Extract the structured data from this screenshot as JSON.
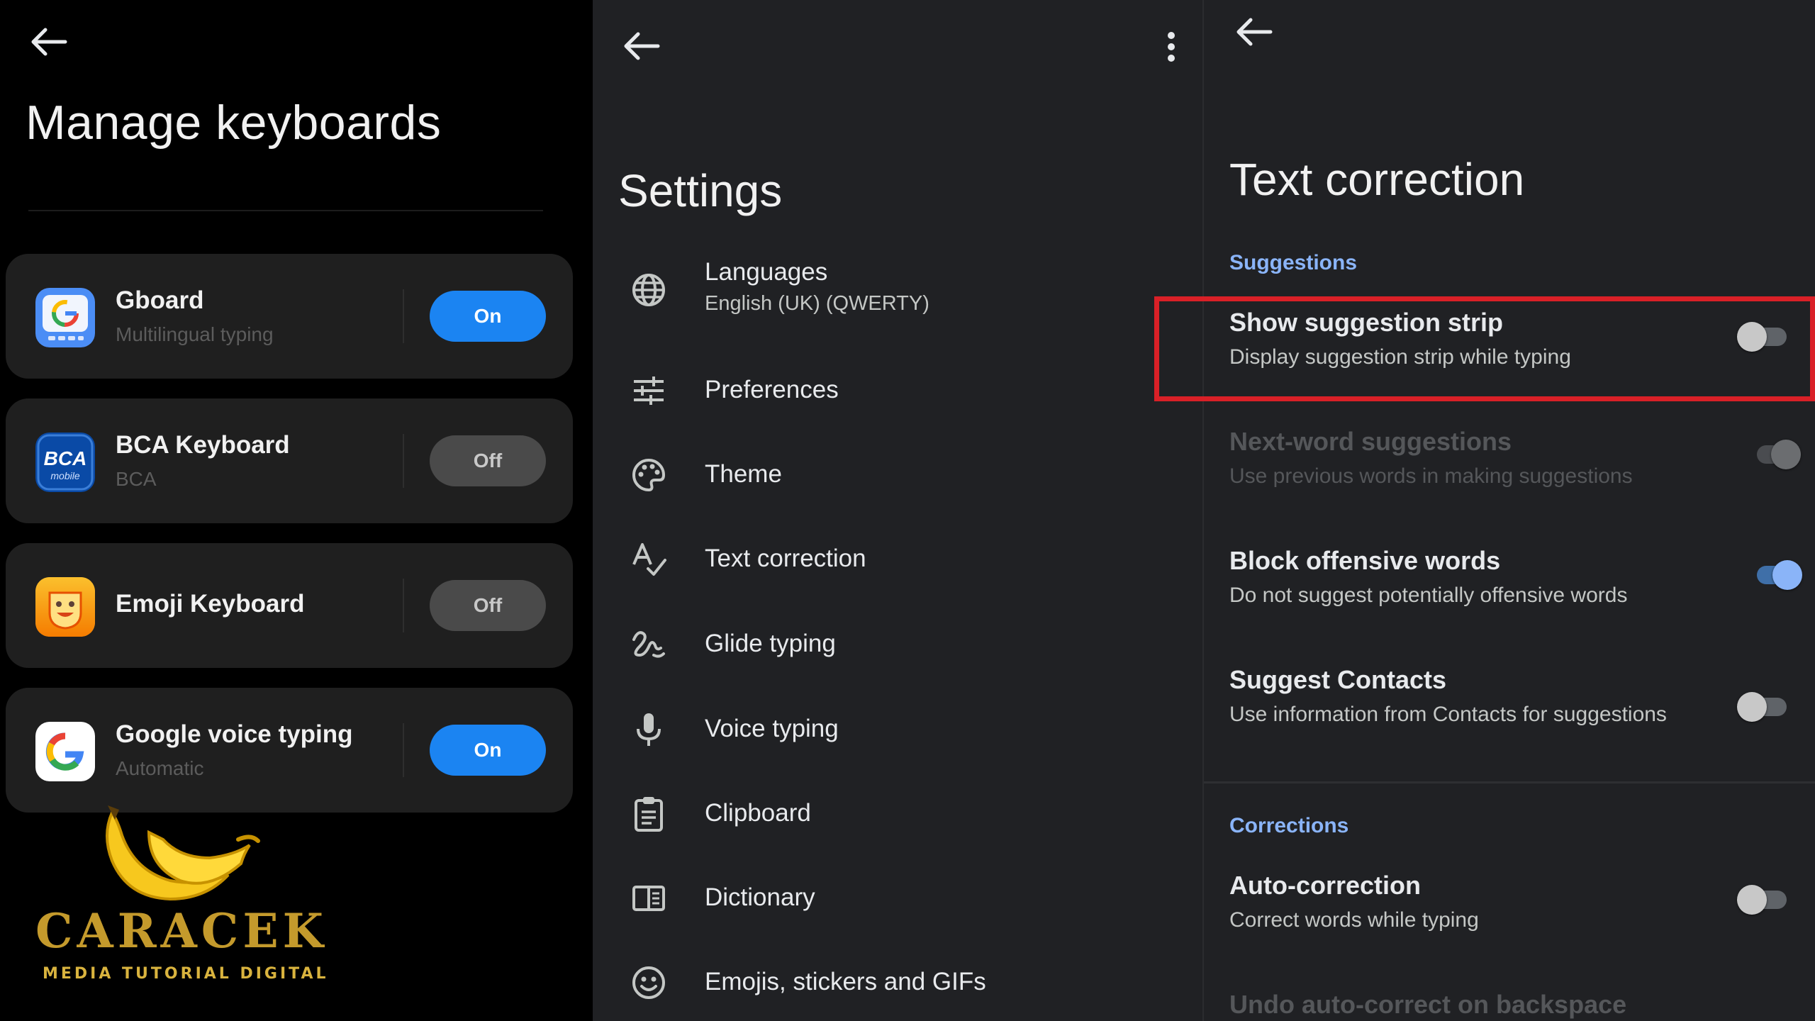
{
  "manage": {
    "title": "Manage keyboards",
    "keyboards": [
      {
        "name": "Gboard",
        "subtitle": "Multilingual typing",
        "status": "On"
      },
      {
        "name": "BCA Keyboard",
        "subtitle": "BCA",
        "status": "Off"
      },
      {
        "name": "Emoji Keyboard",
        "subtitle": "",
        "status": "Off"
      },
      {
        "name": "Google voice typing",
        "subtitle": "Automatic",
        "status": "On"
      }
    ],
    "bca_logo_text": "BCA",
    "bca_logo_sub": "mobile"
  },
  "watermark": {
    "brand": "CARACEK",
    "tagline": "MEDIA TUTORIAL DIGITAL"
  },
  "settings": {
    "title": "Settings",
    "items": [
      {
        "label": "Languages",
        "subtitle": "English (UK) (QWERTY)",
        "icon": "globe-icon"
      },
      {
        "label": "Preferences",
        "icon": "sliders-icon"
      },
      {
        "label": "Theme",
        "icon": "palette-icon"
      },
      {
        "label": "Text correction",
        "icon": "spellcheck-icon"
      },
      {
        "label": "Glide typing",
        "icon": "gesture-icon"
      },
      {
        "label": "Voice typing",
        "icon": "mic-icon"
      },
      {
        "label": "Clipboard",
        "icon": "clipboard-icon"
      },
      {
        "label": "Dictionary",
        "icon": "book-icon"
      },
      {
        "label": "Emojis, stickers and GIFs",
        "icon": "smiley-icon"
      }
    ]
  },
  "text_correction": {
    "title": "Text correction",
    "sections": {
      "suggestions": "Suggestions",
      "corrections": "Corrections"
    },
    "items": [
      {
        "label": "Show suggestion strip",
        "subtitle": "Display suggestion strip while typing",
        "state": "off"
      },
      {
        "label": "Next-word suggestions",
        "subtitle": "Use previous words in making suggestions",
        "state": "disabled"
      },
      {
        "label": "Block offensive words",
        "subtitle": "Do not suggest potentially offensive words",
        "state": "on"
      },
      {
        "label": "Suggest Contacts",
        "subtitle": "Use information from Contacts for suggestions",
        "state": "off"
      },
      {
        "label": "Auto-correction",
        "subtitle": "Correct words while typing",
        "state": "off"
      },
      {
        "label": "Undo auto-correct on backspace",
        "subtitle": "",
        "state": "off"
      }
    ]
  },
  "colors": {
    "accent_blue": "#1b84f2",
    "section_blue": "#8ab4f8",
    "highlight_red": "#d92027"
  }
}
